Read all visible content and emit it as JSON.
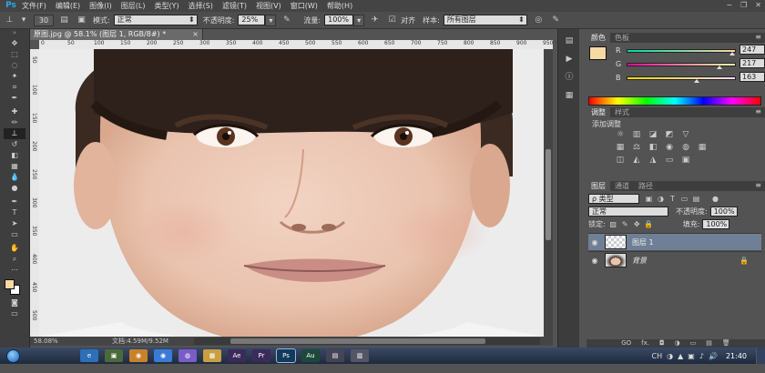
{
  "app": {
    "logo": "Ps"
  },
  "menu": [
    "文件(F)",
    "编辑(E)",
    "图像(I)",
    "图层(L)",
    "类型(Y)",
    "选择(S)",
    "滤镜(T)",
    "视图(V)",
    "窗口(W)",
    "帮助(H)"
  ],
  "window_controls": {
    "minimize": "−",
    "restore": "❐",
    "close": "✕"
  },
  "options": {
    "brush_size": "30",
    "mode_label": "模式:",
    "mode_value": "正常",
    "opacity_label": "不透明度:",
    "opacity_value": "25%",
    "flow_label": "流量:",
    "flow_value": "100%",
    "aligned_label": "对齐",
    "sample_label": "样本:",
    "sample_value": "所有图层"
  },
  "document": {
    "tab_title": "原图.jpg @ 58.1% (图层 1, RGB/8#) *",
    "close": "×",
    "zoom": "58.08%",
    "info": "文档:4.59M/9.52M",
    "ruler_top": [
      "0",
      "50",
      "100",
      "150",
      "200",
      "250",
      "300",
      "350",
      "400",
      "450",
      "500",
      "550",
      "600",
      "650",
      "700",
      "750",
      "800",
      "850",
      "900",
      "950"
    ],
    "ruler_left": [
      "50",
      "100",
      "150",
      "200",
      "250",
      "300",
      "350",
      "400",
      "450",
      "500"
    ]
  },
  "color_panel": {
    "tabs": [
      "颜色",
      "色板"
    ],
    "channels": [
      {
        "label": "R",
        "value": "247",
        "fraction": 0.969
      },
      {
        "label": "G",
        "value": "217",
        "fraction": 0.851
      },
      {
        "label": "B",
        "value": "163",
        "fraction": 0.639
      }
    ],
    "fg_color": "#f7d9a3"
  },
  "adjust_panel": {
    "tabs": [
      "调整",
      "样式"
    ],
    "title": "添加调整"
  },
  "layers_panel": {
    "tabs": [
      "图层",
      "通道",
      "路径"
    ],
    "filter_value": "ρ 类型",
    "blend_value": "正常",
    "opacity_label": "不透明度:",
    "opacity_value": "100%",
    "lock_label": "锁定:",
    "fill_label": "填充:",
    "fill_value": "100%",
    "layers": [
      {
        "name": "图层 1",
        "selected": true
      },
      {
        "name": "背景",
        "selected": false
      }
    ],
    "footer_icons": [
      "GO",
      "fx.",
      "◘",
      "◑",
      "▭",
      "▤",
      "🗑"
    ]
  },
  "taskbar": {
    "apps": [
      {
        "label": "e",
        "color": "#2d6fb8"
      },
      {
        "label": "▣",
        "color": "#4a6a3a"
      },
      {
        "label": "◉",
        "color": "#c9822a"
      },
      {
        "label": "◉",
        "color": "#3a7bd5"
      },
      {
        "label": "◍",
        "color": "#7a5cc8"
      },
      {
        "label": "▦",
        "color": "#c8a040"
      },
      {
        "label": "Ae",
        "color": "#3c2b5a"
      },
      {
        "label": "Pr",
        "color": "#3c2b5a"
      },
      {
        "label": "Ps",
        "color": "#123a5a",
        "active": true
      },
      {
        "label": "Au",
        "color": "#1c4a3a"
      },
      {
        "label": "▤",
        "color": "#445"
      },
      {
        "label": "▥",
        "color": "#556"
      }
    ],
    "tray": [
      "CH",
      "◑",
      "▲",
      "▣",
      "♪",
      "🔊"
    ],
    "clock": "21:40"
  }
}
